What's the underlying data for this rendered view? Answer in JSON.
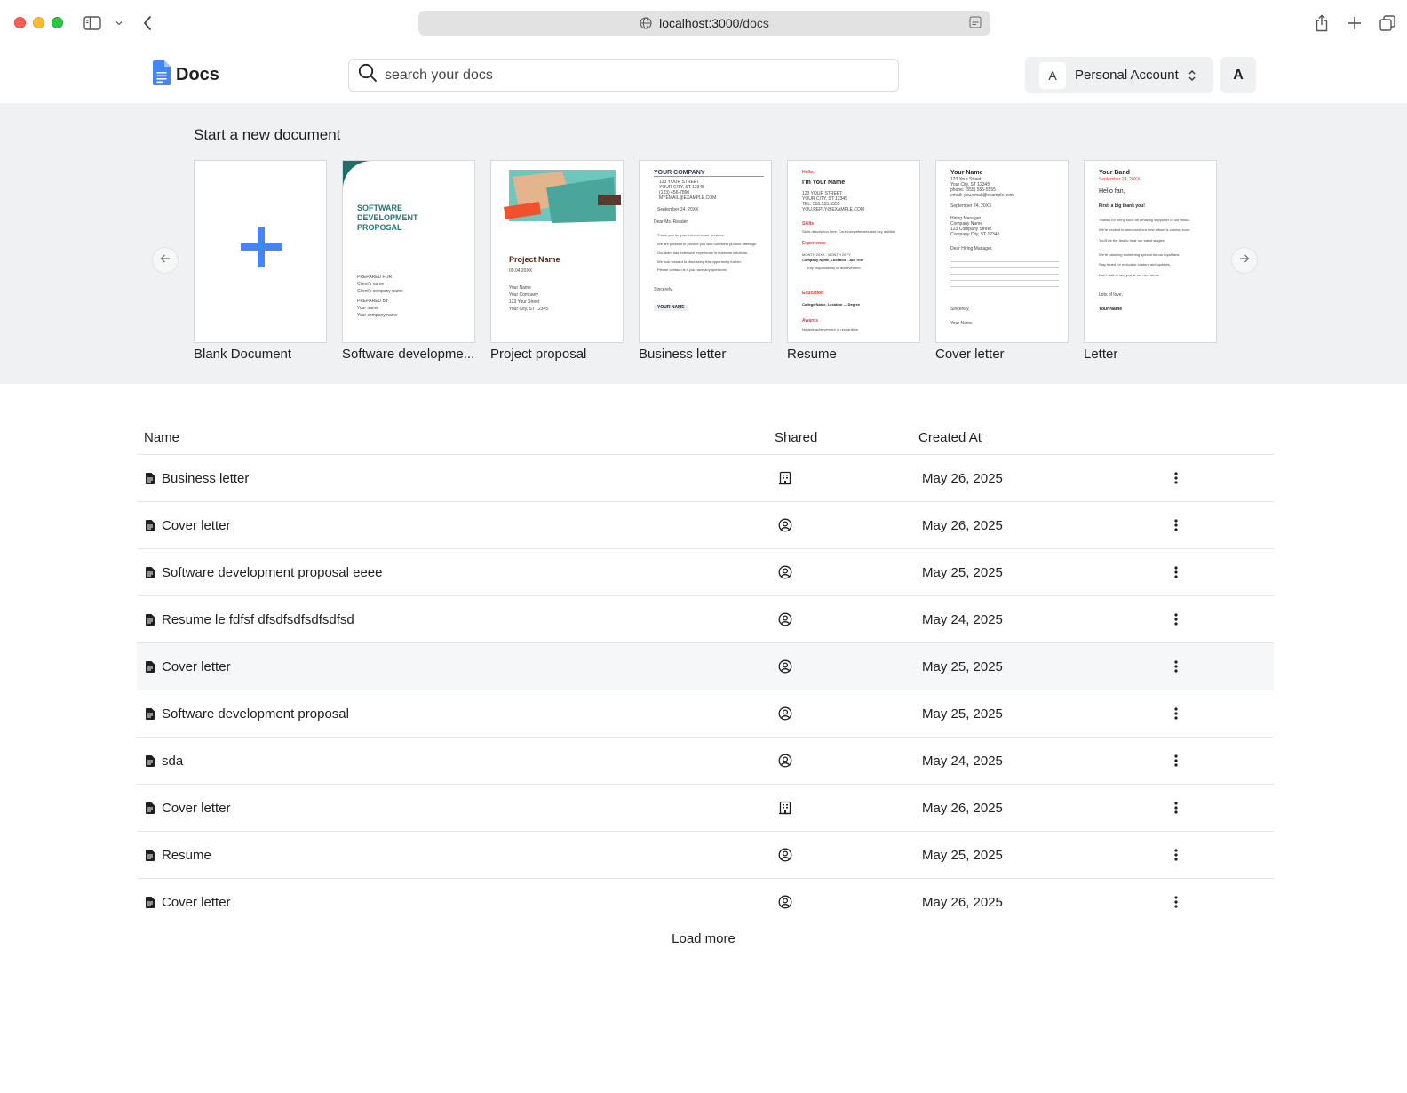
{
  "browser": {
    "url_host": "localhost:3000",
    "url_path": "/docs"
  },
  "header": {
    "app_title": "Docs",
    "search_placeholder": "search your docs",
    "account_initial": "A",
    "account_name": "Personal Account",
    "user_initial": "A"
  },
  "templates": {
    "heading": "Start a new document",
    "items": [
      {
        "label": "Blank Document"
      },
      {
        "label": "Software developme..."
      },
      {
        "label": "Project proposal"
      },
      {
        "label": "Business letter"
      },
      {
        "label": "Resume"
      },
      {
        "label": "Cover letter"
      },
      {
        "label": "Letter"
      }
    ],
    "previews": {
      "software": {
        "title1": "SOFTWARE",
        "title2": "DEVELOPMENT",
        "title3": "PROPOSAL",
        "prepared_for": "PREPARED FOR",
        "client_name": "Client's name",
        "client_company": "Client's company name",
        "prepared_by": "PREPARED BY",
        "your_name": "Your name",
        "your_company": "Your company name"
      },
      "project": {
        "title": "Project Name",
        "date": "09.04.20XX",
        "name": "Your Name",
        "company": "Your Company",
        "street": "123 Your Street",
        "city": "Your City, ST 12345"
      },
      "business": {
        "company": "YOUR COMPANY",
        "street": "123 YOUR STREET",
        "city": "YOUR CITY, ST 12345",
        "phone": "(123) 456-7890",
        "email": "MYEMAIL@EXAMPLE.COM",
        "date": "September 24, 20XX",
        "greeting": "Dear Ms. Reader,",
        "p1": "Thank you for your interest in our services.",
        "p2": "We are pleased to provide you with our latest product offerings.",
        "p3": "Our team has extensive experience in business solutions.",
        "p4": "We look forward to discussing this opportunity further.",
        "p5": "Please contact us if you have any questions.",
        "closing": "Sincerely,",
        "sign": "YOUR NAME"
      },
      "resume": {
        "hello": "Hello,",
        "name": "I'm Your Name",
        "street": "123 YOUR STREET",
        "city": "YOUR CITY, ST 12345",
        "tel": "TEL: 555.555.5555",
        "email": "YOU.REPLY@EXAMPLE.COM",
        "skills": "Skills",
        "skills_text": "Skills description here. Core competencies and key abilities",
        "experience": "Experience",
        "dates": "MONTH 20XX - MONTH 20YY",
        "job": "Company Name, Location - Job Title",
        "bullet": "Key responsibility or achievement",
        "education": "Education",
        "college": "College Name, Location — Degree",
        "awards": "Awards",
        "award_text": "Notable achievement or recognition"
      },
      "cover": {
        "name": "Your Name",
        "street": "123 Your Street",
        "city": "Your City, ST 12345",
        "phone": "phone: (555) 555-5555",
        "email": "email: you.email@example.com",
        "date": "September 24, 20XX",
        "manager": "Hiring Manager",
        "company": "Company Name",
        "company_street": "123 Company Street",
        "company_city": "Company City, ST 12345",
        "greeting": "Dear Hiring Manager,",
        "closing": "Sincerely,",
        "sign": "Your Name"
      },
      "letter": {
        "band": "Your Band",
        "date": "September 24, 20XX",
        "hello": "Hello fan,",
        "thanks": "First, a big thank you!",
        "p1": "Thanks for being such an amazing supporter of our music.",
        "p2": "We're excited to announce our new album is coming soon.",
        "p3": "You'll be the first to hear our latest singles.",
        "p4": "We're planning something special for our loyal fans.",
        "p5": "Stay tuned for exclusive content and updates.",
        "p6": "Can't wait to see you at our next show.",
        "closing": "Lots of love,",
        "sign": "Your Name"
      }
    }
  },
  "table": {
    "columns": {
      "name": "Name",
      "shared": "Shared",
      "created": "Created At"
    },
    "rows": [
      {
        "name": "Business letter",
        "shared": "building-icon",
        "date": "May 26, 2025"
      },
      {
        "name": "Cover letter",
        "shared": "user-circle-icon",
        "date": "May 26, 2025"
      },
      {
        "name": "Software development proposal eeee",
        "shared": "user-circle-icon",
        "date": "May 25, 2025"
      },
      {
        "name": "Resume le fdfsf dfsdfsdfsdfsdfsd",
        "shared": "user-circle-icon",
        "date": "May 24, 2025"
      },
      {
        "name": "Cover letter",
        "shared": "user-circle-icon",
        "date": "May 25, 2025"
      },
      {
        "name": "Software development proposal",
        "shared": "user-circle-icon",
        "date": "May 25, 2025"
      },
      {
        "name": "sda",
        "shared": "user-circle-icon",
        "date": "May 24, 2025"
      },
      {
        "name": "Cover letter",
        "shared": "building-icon",
        "date": "May 26, 2025"
      },
      {
        "name": "Resume",
        "shared": "user-circle-icon",
        "date": "May 25, 2025"
      },
      {
        "name": "Cover letter",
        "shared": "user-circle-icon",
        "date": "May 26, 2025"
      }
    ],
    "load_more": "Load more"
  },
  "colors": {
    "brand_blue": "#4285f4",
    "gallery_bg": "#f0f1f3",
    "teal": "#1f7a73"
  }
}
